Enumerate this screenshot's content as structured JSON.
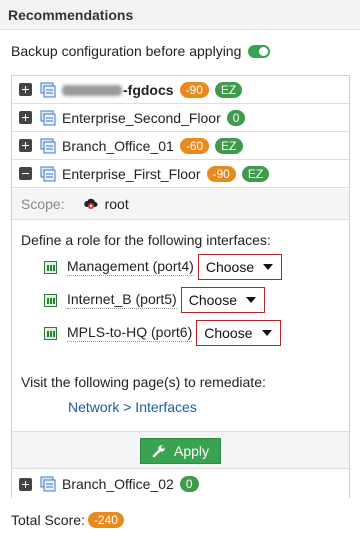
{
  "header": {
    "title": "Recommendations"
  },
  "backup": {
    "label": "Backup configuration before applying",
    "enabled": true,
    "toggle_color": "#3aa352"
  },
  "devices": [
    {
      "name": "-fgdocs",
      "obscured_prefix": true,
      "expanded": false,
      "score": "-90",
      "badge": "EZ"
    },
    {
      "name": "Enterprise_Second_Floor",
      "expanded": false,
      "score": "0"
    },
    {
      "name": "Branch_Office_01",
      "expanded": false,
      "score": "-60",
      "badge": "EZ"
    },
    {
      "name": "Enterprise_First_Floor",
      "expanded": true,
      "score": "-90",
      "badge": "EZ"
    },
    {
      "name": "Branch_Office_02",
      "expanded": false,
      "score": "0"
    }
  ],
  "scope": {
    "label": "Scope:",
    "value": "root"
  },
  "define": {
    "text": "Define a role for the following interfaces:"
  },
  "interfaces": [
    {
      "label": "Management (port4)",
      "role": "Choose"
    },
    {
      "label": "Internet_B (port5)",
      "role": "Choose"
    },
    {
      "label": "MPLS-to-HQ (port6)",
      "role": "Choose"
    }
  ],
  "remediate": {
    "text": "Visit the following page(s) to remediate:",
    "link": "Network > Interfaces"
  },
  "apply": {
    "label": "Apply"
  },
  "total": {
    "label": "Total Score:",
    "value": "-240"
  },
  "colors": {
    "orange_badge": "#e98a1f",
    "green_badge": "#3f9a4c",
    "link": "#1e5aa8",
    "error_border": "#b4242a"
  }
}
